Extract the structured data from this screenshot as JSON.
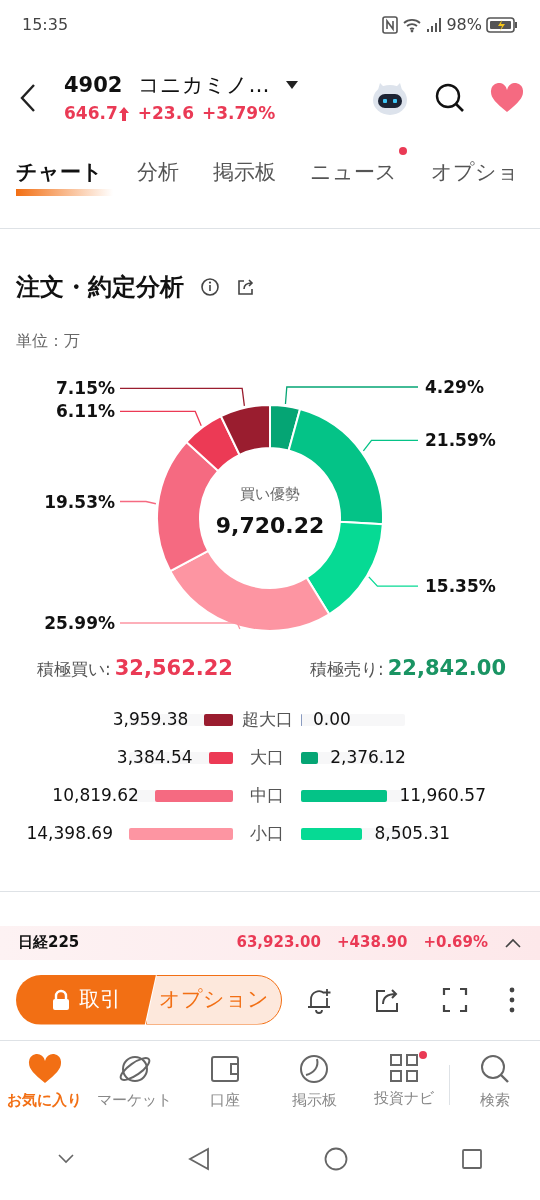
{
  "status_bar": {
    "time": "15:35",
    "battery": "98%"
  },
  "header": {
    "code": "4902",
    "name": "コニカミノ…",
    "price": "646.7",
    "change": "+23.6",
    "change_pct": "+3.79%"
  },
  "tabs": [
    {
      "label": "チャート",
      "selected": true,
      "dot": false
    },
    {
      "label": "分析",
      "selected": false,
      "dot": false
    },
    {
      "label": "掲示板",
      "selected": false,
      "dot": false
    },
    {
      "label": "ニュース",
      "selected": false,
      "dot": true
    },
    {
      "label": "オプショ",
      "selected": false,
      "dot": false
    }
  ],
  "section": {
    "title": "注文・約定分析",
    "unit": "単位：万",
    "chart_data": {
      "type": "donut",
      "values": [
        4.29,
        21.59,
        15.35,
        25.99,
        19.53,
        6.11,
        7.15
      ],
      "colors": [
        "#05a574",
        "#04c387",
        "#06da94",
        "#fd95a2",
        "#f56a81",
        "#ec3a55",
        "#9a1d2f"
      ],
      "value_labels": [
        "4.29%",
        "21.59%",
        "15.35%",
        "25.99%",
        "19.53%",
        "6.11%",
        "7.15%"
      ]
    },
    "center_label": "買い優勢",
    "center_value": "9,720.22",
    "buy_label": "積極買い:",
    "buy_total": "32,562.22",
    "sell_label": "積極売り:",
    "sell_total": "22,842.00",
    "rows": [
      {
        "label": "超大口",
        "buy": {
          "value": "3,959.38",
          "level": 0.275,
          "color": "#9a1d2f"
        },
        "sell": {
          "value": "0.00",
          "level": 0,
          "color": "#8a9bc0"
        }
      },
      {
        "label": "大口",
        "buy": {
          "value": "3,384.54",
          "level": 0.235,
          "color": "#ec3a55"
        },
        "sell": {
          "value": "2,376.12",
          "level": 0.165,
          "color": "#05a574"
        }
      },
      {
        "label": "中口",
        "buy": {
          "value": "10,819.62",
          "level": 0.751,
          "color": "#f56a81"
        },
        "sell": {
          "value": "11,960.57",
          "level": 0.831,
          "color": "#04c387"
        }
      },
      {
        "label": "小口",
        "buy": {
          "value": "14,398.69",
          "level": 1,
          "color": "#fd95a2"
        },
        "sell": {
          "value": "8,505.31",
          "level": 0.591,
          "color": "#06da94"
        }
      }
    ]
  },
  "ticker": {
    "name": "日経225",
    "value": "63,923.00",
    "change": "+438.90",
    "change_pct": "+0.69%"
  },
  "actions": {
    "trade": "取引",
    "option": "オプション"
  },
  "bottom_nav": [
    {
      "label": "お気に入り",
      "selected": true,
      "dot": false
    },
    {
      "label": "マーケット",
      "selected": false,
      "dot": false
    },
    {
      "label": "口座",
      "selected": false,
      "dot": false
    },
    {
      "label": "掲示板",
      "selected": false,
      "dot": false
    },
    {
      "label": "投資ナビ",
      "selected": false,
      "dot": true
    },
    {
      "label": "検索",
      "selected": false,
      "dot": false
    }
  ]
}
